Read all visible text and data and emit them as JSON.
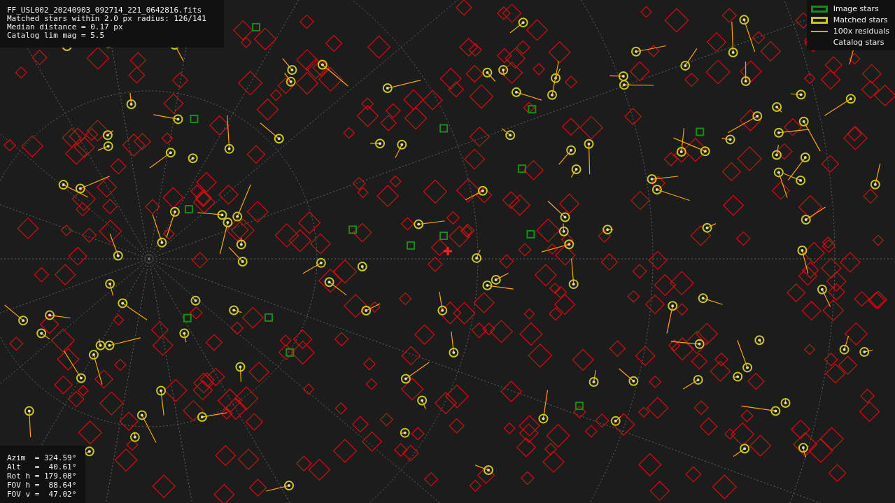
{
  "info_panel": {
    "lines": [
      "FF_USL002_20240903_092714_221_0642816.fits",
      "Matched stars within 2.0 px radius: 126/141",
      "Median distance = 0.17 px",
      "Catalog lim mag = 5.5"
    ]
  },
  "legend": {
    "items": [
      {
        "label": "Image stars",
        "kind": "box",
        "color": "#1a8a1a"
      },
      {
        "label": "Matched stars",
        "kind": "box",
        "color": "#c8c81e"
      },
      {
        "label": "100x residuals",
        "kind": "line",
        "color": "#ffa500"
      },
      {
        "label": "Catalog stars",
        "kind": "none"
      }
    ]
  },
  "pointing_panel": {
    "lines": [
      "Azim  = 324.59°",
      "Alt   =  40.61°",
      "Rot h = 179.08°",
      "FOV h =  88.64°",
      "FOV v =  47.02°"
    ]
  }
}
